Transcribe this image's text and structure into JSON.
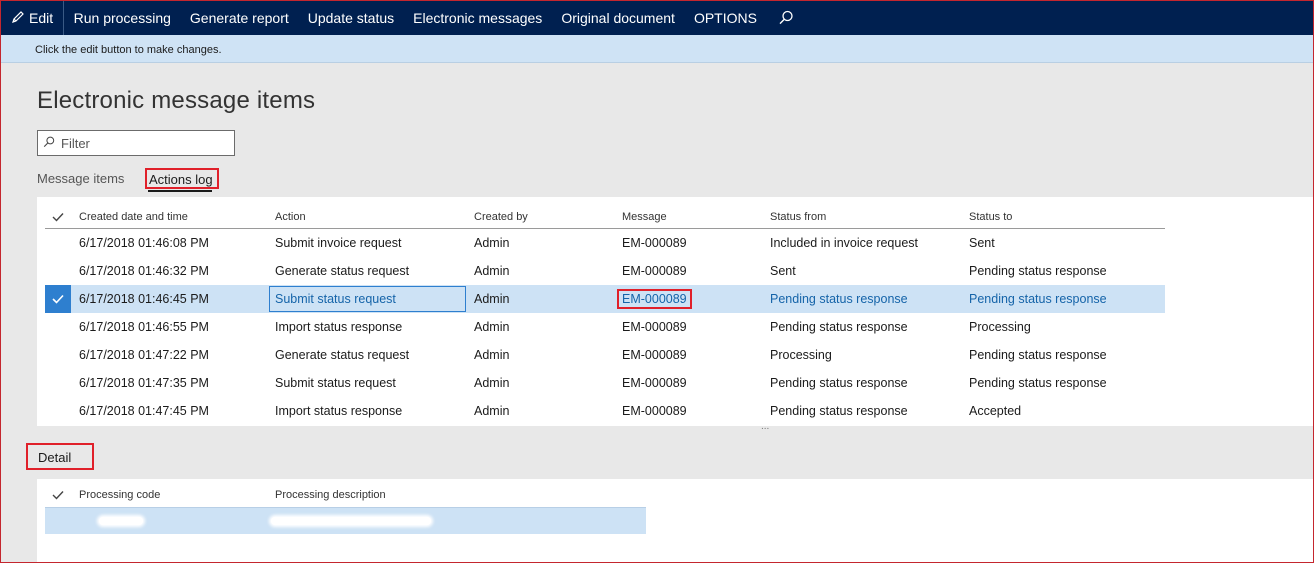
{
  "toolbar": {
    "edit_label": "Edit",
    "items": [
      "Run processing",
      "Generate report",
      "Update status",
      "Electronic messages",
      "Original document",
      "OPTIONS"
    ]
  },
  "info": {
    "message": "Click the edit button to make changes."
  },
  "page": {
    "title": "Electronic message items"
  },
  "filter": {
    "placeholder": "Filter"
  },
  "tabs": {
    "message_items": "Message items",
    "actions_log": "Actions log"
  },
  "actions_grid": {
    "columns": [
      "Created date and time",
      "Action",
      "Created by",
      "Message",
      "Status from",
      "Status to"
    ],
    "rows": [
      {
        "created": "6/17/2018 01:46:08 PM",
        "action": "Submit invoice request",
        "by": "Admin",
        "message": "EM-000089",
        "from": "Included in invoice request",
        "to": "Sent"
      },
      {
        "created": "6/17/2018 01:46:32 PM",
        "action": "Generate status request",
        "by": "Admin",
        "message": "EM-000089",
        "from": "Sent",
        "to": "Pending status response"
      },
      {
        "created": "6/17/2018 01:46:45 PM",
        "action": "Submit status request",
        "by": "Admin",
        "message": "EM-000089",
        "from": "Pending status response",
        "to": "Pending status response"
      },
      {
        "created": "6/17/2018 01:46:55 PM",
        "action": "Import status response",
        "by": "Admin",
        "message": "EM-000089",
        "from": "Pending status response",
        "to": "Processing"
      },
      {
        "created": "6/17/2018 01:47:22 PM",
        "action": "Generate status request",
        "by": "Admin",
        "message": "EM-000089",
        "from": "Processing",
        "to": "Pending status response"
      },
      {
        "created": "6/17/2018 01:47:35 PM",
        "action": "Submit status request",
        "by": "Admin",
        "message": "EM-000089",
        "from": "Pending status response",
        "to": "Pending status response"
      },
      {
        "created": "6/17/2018 01:47:45 PM",
        "action": "Import status response",
        "by": "Admin",
        "message": "EM-000089",
        "from": "Pending status response",
        "to": "Accepted"
      }
    ],
    "more": "..."
  },
  "detail": {
    "title": "Detail",
    "columns": [
      "Processing code",
      "Processing description"
    ]
  },
  "colors": {
    "nav_bg": "#002050",
    "info_bg": "#cfe3f5",
    "selection": "#cde2f5",
    "accent": "#2e7fcf",
    "highlight_box": "#e0202a"
  }
}
